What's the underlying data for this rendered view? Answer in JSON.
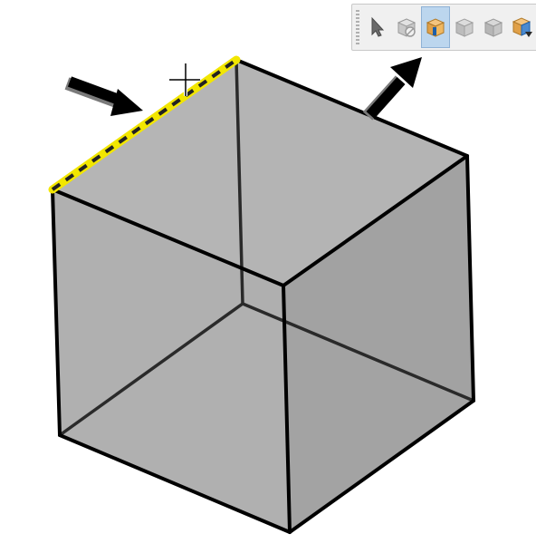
{
  "viewport": {
    "background_color": "#ffffff"
  },
  "model": {
    "object": "cube",
    "face_color": "#b4b4b4",
    "edge_color": "#000000",
    "selected_edge": "top-left edge",
    "highlight_color": "#f2e600"
  },
  "annotations": [
    {
      "kind": "arrow",
      "points_to": "selected-edge"
    },
    {
      "kind": "arrow",
      "points_to": "selection-toolbar"
    }
  ],
  "cursor": {
    "icon": "crosshair-cursor-icon"
  },
  "toolbar": {
    "buttons": [
      {
        "icon": "select-arrow-icon",
        "active": false
      },
      {
        "icon": "select-other-icon",
        "active": false
      },
      {
        "icon": "select-face-icon",
        "active": true
      },
      {
        "icon": "select-body-icon",
        "active": false
      },
      {
        "icon": "select-part-icon",
        "active": false
      },
      {
        "icon": "select-component-icon",
        "active": false
      }
    ],
    "active_color": "#bcd6ee"
  }
}
